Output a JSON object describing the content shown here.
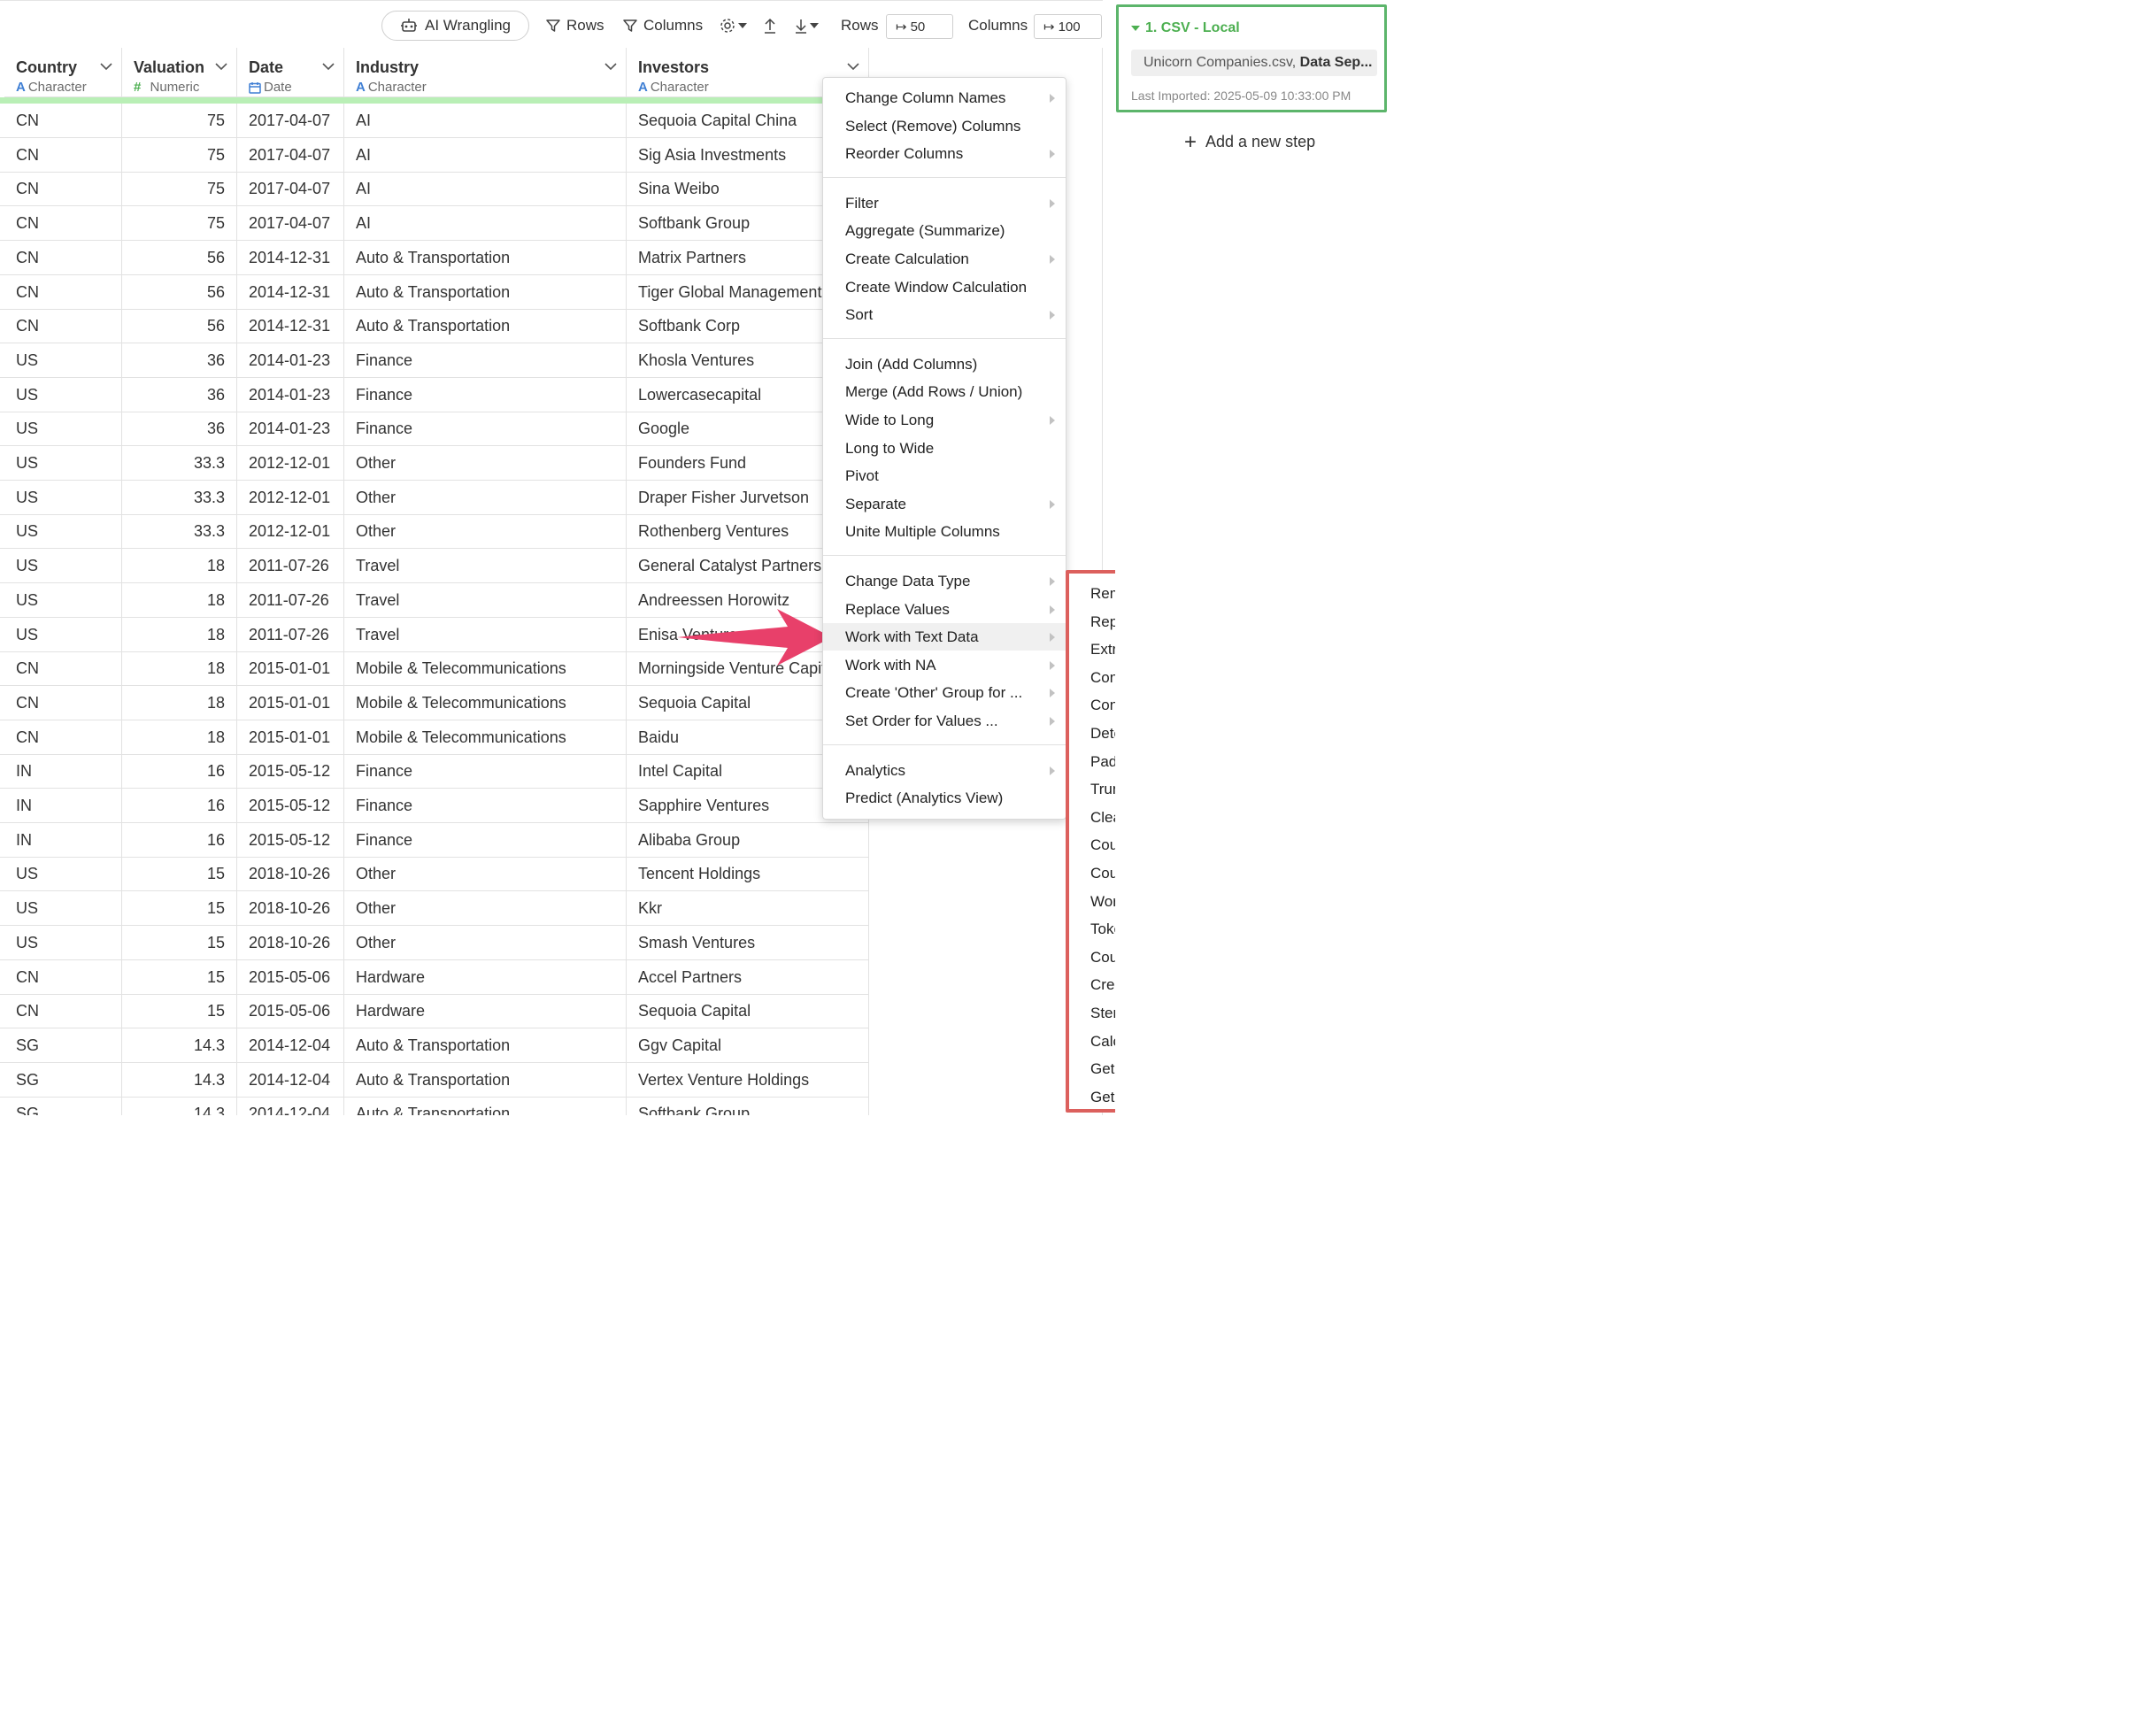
{
  "toolbar": {
    "ai_wrangling": "AI Wrangling",
    "rows_filter": "Rows",
    "columns_filter": "Columns",
    "rows_label": "Rows",
    "rows_value": "50",
    "columns_label": "Columns",
    "columns_value": "100"
  },
  "columns": [
    {
      "name": "Country",
      "type": "Character",
      "type_icon": "A"
    },
    {
      "name": "Valuation",
      "type": "Numeric",
      "type_icon": "#"
    },
    {
      "name": "Date",
      "type": "Date",
      "type_icon": "calendar-icon"
    },
    {
      "name": "Industry",
      "type": "Character",
      "type_icon": "A"
    },
    {
      "name": "Investors",
      "type": "Character",
      "type_icon": "A"
    }
  ],
  "rows": [
    [
      "CN",
      "75",
      "2017-04-07",
      "AI",
      "Sequoia Capital China"
    ],
    [
      "CN",
      "75",
      "2017-04-07",
      "AI",
      "Sig Asia Investments"
    ],
    [
      "CN",
      "75",
      "2017-04-07",
      "AI",
      "Sina Weibo"
    ],
    [
      "CN",
      "75",
      "2017-04-07",
      "AI",
      "Softbank Group"
    ],
    [
      "CN",
      "56",
      "2014-12-31",
      "Auto & Transportation",
      "Matrix Partners"
    ],
    [
      "CN",
      "56",
      "2014-12-31",
      "Auto & Transportation",
      "Tiger Global Management"
    ],
    [
      "CN",
      "56",
      "2014-12-31",
      "Auto & Transportation",
      "Softbank Corp"
    ],
    [
      "US",
      "36",
      "2014-01-23",
      "Finance",
      "Khosla Ventures"
    ],
    [
      "US",
      "36",
      "2014-01-23",
      "Finance",
      "Lowercasecapital"
    ],
    [
      "US",
      "36",
      "2014-01-23",
      "Finance",
      "Google"
    ],
    [
      "US",
      "33.3",
      "2012-12-01",
      "Other",
      "Founders Fund"
    ],
    [
      "US",
      "33.3",
      "2012-12-01",
      "Other",
      "Draper Fisher Jurvetson"
    ],
    [
      "US",
      "33.3",
      "2012-12-01",
      "Other",
      "Rothenberg Ventures"
    ],
    [
      "US",
      "18",
      "2011-07-26",
      "Travel",
      "General Catalyst Partners"
    ],
    [
      "US",
      "18",
      "2011-07-26",
      "Travel",
      "Andreessen Horowitz"
    ],
    [
      "US",
      "18",
      "2011-07-26",
      "Travel",
      "Enisa Ventures"
    ],
    [
      "CN",
      "18",
      "2015-01-01",
      "Mobile & Telecommunications",
      "Morningside Venture Capital"
    ],
    [
      "CN",
      "18",
      "2015-01-01",
      "Mobile & Telecommunications",
      "Sequoia Capital"
    ],
    [
      "CN",
      "18",
      "2015-01-01",
      "Mobile & Telecommunications",
      "Baidu"
    ],
    [
      "IN",
      "16",
      "2015-05-12",
      "Finance",
      "Intel Capital"
    ],
    [
      "IN",
      "16",
      "2015-05-12",
      "Finance",
      "Sapphire Ventures"
    ],
    [
      "IN",
      "16",
      "2015-05-12",
      "Finance",
      "Alibaba Group"
    ],
    [
      "US",
      "15",
      "2018-10-26",
      "Other",
      "Tencent Holdings"
    ],
    [
      "US",
      "15",
      "2018-10-26",
      "Other",
      "Kkr"
    ],
    [
      "US",
      "15",
      "2018-10-26",
      "Other",
      "Smash Ventures"
    ],
    [
      "CN",
      "15",
      "2015-05-06",
      "Hardware",
      "Accel Partners"
    ],
    [
      "CN",
      "15",
      "2015-05-06",
      "Hardware",
      "Sequoia Capital"
    ],
    [
      "SG",
      "14.3",
      "2014-12-04",
      "Auto & Transportation",
      "Ggv Capital"
    ],
    [
      "SG",
      "14.3",
      "2014-12-04",
      "Auto & Transportation",
      "Vertex Venture Holdings"
    ],
    [
      "SG",
      "14.3",
      "2014-12-04",
      "Auto & Transportation",
      "Softbank Group"
    ]
  ],
  "menu": {
    "groups": [
      [
        {
          "label": "Change Column Names",
          "submenu": true
        },
        {
          "label": "Select (Remove) Columns",
          "submenu": false
        },
        {
          "label": "Reorder Columns",
          "submenu": true
        }
      ],
      [
        {
          "label": "Filter",
          "submenu": true
        },
        {
          "label": "Aggregate (Summarize)",
          "submenu": false
        },
        {
          "label": "Create Calculation",
          "submenu": true
        },
        {
          "label": "Create Window Calculation",
          "submenu": false
        },
        {
          "label": "Sort",
          "submenu": true
        }
      ],
      [
        {
          "label": "Join (Add Columns)",
          "submenu": false
        },
        {
          "label": "Merge (Add Rows / Union)",
          "submenu": false
        },
        {
          "label": "Wide to Long",
          "submenu": true
        },
        {
          "label": "Long to Wide",
          "submenu": false
        },
        {
          "label": "Pivot",
          "submenu": false
        },
        {
          "label": "Separate",
          "submenu": true
        },
        {
          "label": "Unite Multiple Columns",
          "submenu": false
        }
      ],
      [
        {
          "label": "Change Data Type",
          "submenu": true
        },
        {
          "label": "Replace Values",
          "submenu": true
        },
        {
          "label": "Work with Text Data",
          "submenu": true,
          "highlighted": true
        },
        {
          "label": "Work with NA",
          "submenu": true
        },
        {
          "label": "Create 'Other' Group for ...",
          "submenu": true
        },
        {
          "label": "Set Order for Values ...",
          "submenu": true
        }
      ],
      [
        {
          "label": "Analytics",
          "submenu": true
        },
        {
          "label": "Predict (Analytics View)",
          "submenu": false
        }
      ]
    ]
  },
  "submenu": {
    "border_color": "#dc605d",
    "items": [
      {
        "label": "Remove",
        "submenu": true
      },
      {
        "label": "Replace",
        "submenu": true
      },
      {
        "label": "Extract",
        "submenu": true
      },
      {
        "label": "Convert",
        "submenu": true
      },
      {
        "label": "Concatenate (Add) Text",
        "submenu": false
      },
      {
        "label": "Detect if it contains ...",
        "submenu": false
      },
      {
        "label": "Pad Text",
        "submenu": false
      },
      {
        "label": "Truncate Text",
        "submenu": false
      },
      {
        "label": "Clean up Text",
        "submenu": false
      },
      {
        "label": "Count Text Length",
        "submenu": false
      },
      {
        "label": "Count Text Matches",
        "submenu": false
      },
      {
        "label": "Work with URL / Email",
        "submenu": true
      },
      {
        "label": "Tokenize Text",
        "submenu": false
      },
      {
        "label": "Count Text Pairs",
        "submenu": false
      },
      {
        "label": "Create N-gram Tokens",
        "submenu": false
      },
      {
        "label": "Stem Words",
        "submenu": false
      },
      {
        "label": "Calculate TF-IDF",
        "submenu": false
      },
      {
        "label": "Get Sentiment of Words",
        "submenu": false
      },
      {
        "label": "Get Sentiment of Sentences",
        "submenu": false
      }
    ]
  },
  "panel": {
    "step_title": "1. CSV - Local",
    "file_name": "Unicorn Companies.csv,",
    "file_extra": "Data Sep...",
    "last_imported": "Last Imported: 2025-05-09 10:33:00 PM",
    "add_step": "Add a new step",
    "accent_color": "#4caf50"
  },
  "annotation": {
    "arrow_color": "#e8406a"
  }
}
